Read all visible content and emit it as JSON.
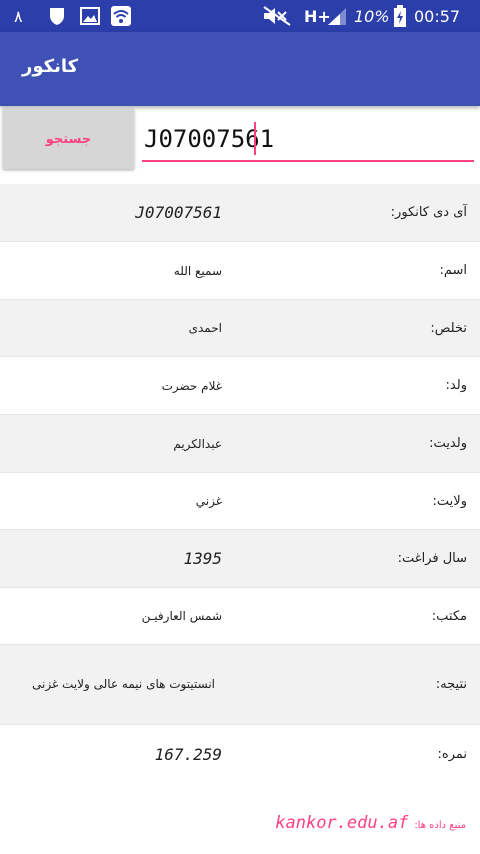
{
  "status_bar": {
    "notification_count": "٨",
    "network": "H+",
    "battery_percent": "10%",
    "time": "00:57"
  },
  "app_bar": {
    "title": "کانکور"
  },
  "search": {
    "button_label": "جستجو",
    "input_value": "J07007561"
  },
  "results": [
    {
      "label": "آی دی کانکور:",
      "value": "J07007561"
    },
    {
      "label": "اسم:",
      "value": "سمیع الله"
    },
    {
      "label": "تخلص:",
      "value": "احمدی"
    },
    {
      "label": "ولد:",
      "value": "غلام حضرت"
    },
    {
      "label": "ولدیت:",
      "value": "عبدالکریم"
    },
    {
      "label": "ولایت:",
      "value": "غزني"
    },
    {
      "label": "سال فراغت:",
      "value": "1395"
    },
    {
      "label": "مکتب:",
      "value": "شمس العارفیـن"
    },
    {
      "label": "نتیجه:",
      "value": "انستیتوت های نیمه عالی ولایت غزنی"
    },
    {
      "label": "نمره:",
      "value": "167.259"
    }
  ],
  "source": {
    "label": "منبع داده ها:",
    "link": "kankor.edu.af"
  },
  "colors": {
    "primary": "#3f51b5",
    "status_bar": "#2b3eaa",
    "accent": "#ff4081"
  }
}
